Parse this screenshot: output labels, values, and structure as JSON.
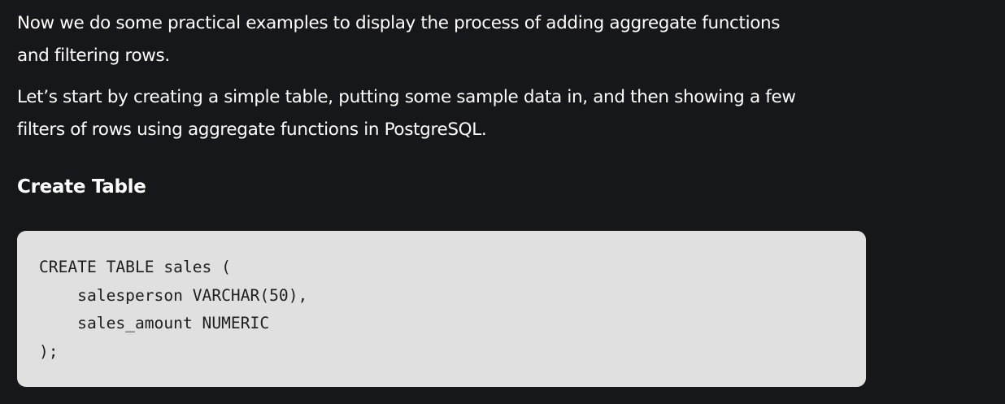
{
  "article": {
    "paragraphs": [
      {
        "lines": [
          "Now we do some practical examples to display the process of adding aggregate functions",
          "and filtering rows."
        ]
      },
      {
        "lines": [
          "Let’s start by creating a simple table, putting some sample data in, and then showing a few",
          "filters of rows using aggregate functions in PostgreSQL."
        ]
      }
    ],
    "section_heading": "Create Table",
    "code_block": {
      "lines": [
        "CREATE TABLE sales (",
        "    salesperson VARCHAR(50),",
        "    sales_amount NUMERIC",
        ");"
      ]
    }
  },
  "colors": {
    "background": "#16171b",
    "text": "#ffffff",
    "code_background": "#e0e0e0",
    "code_text": "#1e1e1e"
  }
}
